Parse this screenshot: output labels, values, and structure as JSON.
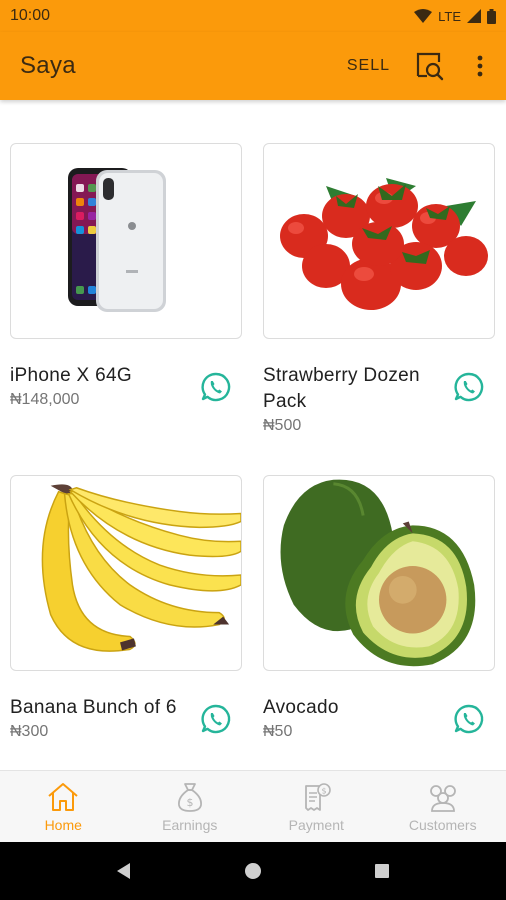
{
  "status_bar": {
    "time": "10:00",
    "network": "LTE"
  },
  "app_bar": {
    "title": "Saya",
    "sell_label": "SELL"
  },
  "products": [
    {
      "name": "iPhone X 64G",
      "price": "₦148,000"
    },
    {
      "name": "Strawberry Dozen Pack",
      "price": "₦500"
    },
    {
      "name": "Banana Bunch of 6",
      "price": "₦300"
    },
    {
      "name": "Avocado",
      "price": "₦50"
    }
  ],
  "bottom_nav": {
    "items": [
      {
        "label": "Home",
        "icon": "home-icon",
        "active": true
      },
      {
        "label": "Earnings",
        "icon": "money-bag-icon",
        "active": false
      },
      {
        "label": "Payment",
        "icon": "receipt-icon",
        "active": false
      },
      {
        "label": "Customers",
        "icon": "customers-icon",
        "active": false
      }
    ]
  },
  "colors": {
    "primary": "#fb9a0b",
    "whatsapp": "#25b59a",
    "inactive": "#b5b5b5"
  }
}
